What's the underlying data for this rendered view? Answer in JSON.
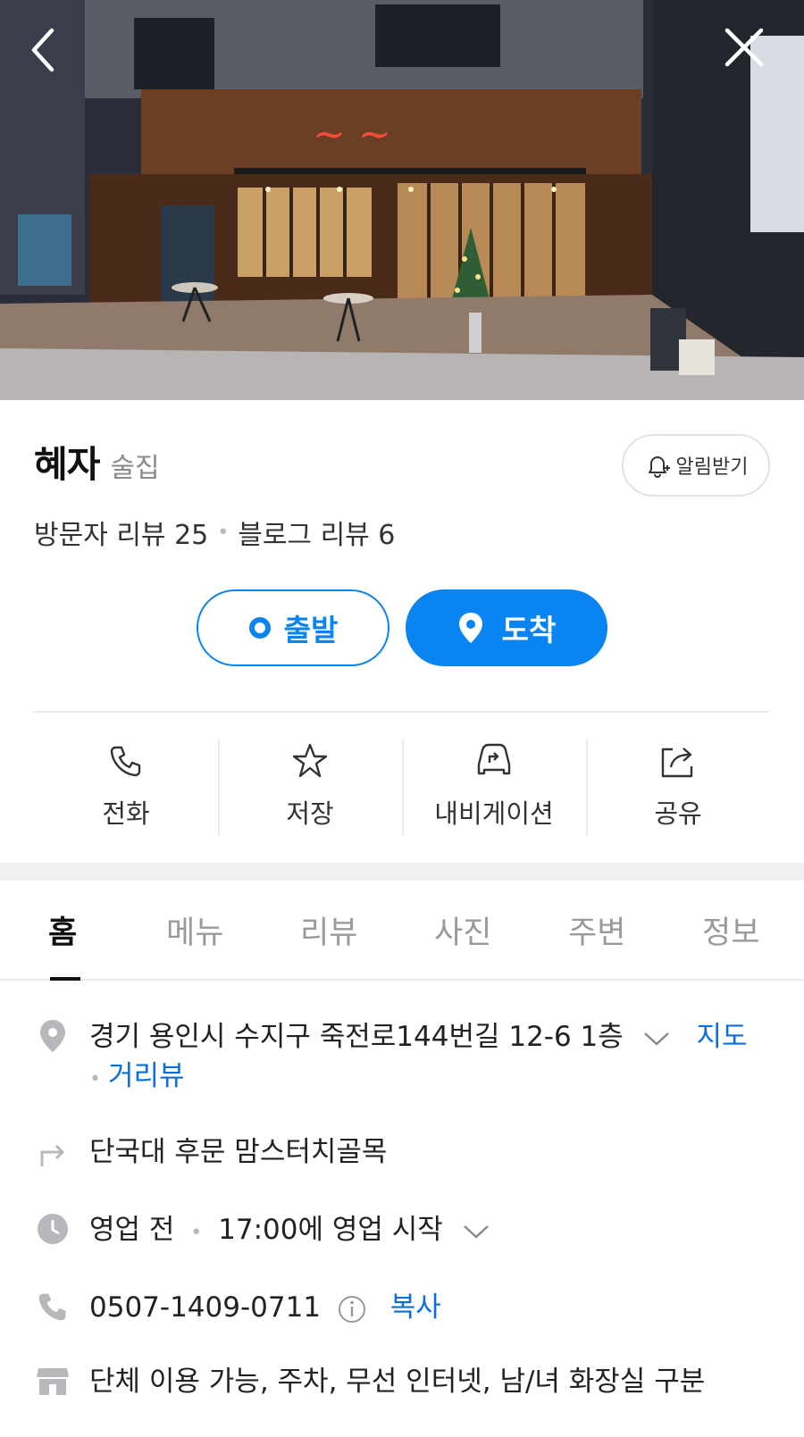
{
  "place": {
    "name": "혜자",
    "category": "술집",
    "alarm_label": "알림받기",
    "visitor_review": "방문자 리뷰 25",
    "blog_review": "블로그 리뷰 6"
  },
  "route": {
    "start_label": "출발",
    "end_label": "도착"
  },
  "actions": [
    {
      "label": "전화",
      "icon": "phone-icon"
    },
    {
      "label": "저장",
      "icon": "star-icon"
    },
    {
      "label": "내비게이션",
      "icon": "car-navigation-icon"
    },
    {
      "label": "공유",
      "icon": "share-icon"
    }
  ],
  "tabs": [
    {
      "label": "홈",
      "active": true
    },
    {
      "label": "메뉴",
      "active": false
    },
    {
      "label": "리뷰",
      "active": false
    },
    {
      "label": "사진",
      "active": false
    },
    {
      "label": "주변",
      "active": false
    },
    {
      "label": "정보",
      "active": false
    }
  ],
  "info": {
    "address": "경기 용인시 수지구 죽전로144번길 12-6 1층",
    "map_link": "지도",
    "street_view_link": "거리뷰",
    "directions": "단국대 후문 맘스터치골목",
    "hours_status": "영업 전",
    "hours_detail": "17:00에 영업 시작",
    "phone": "0507-1409-0711",
    "copy_link": "복사",
    "amenities": "단체 이용 가능, 주차, 무선 인터넷, 남/녀 화장실 구분"
  },
  "colors": {
    "accent": "#0a84f0",
    "link": "#0a6fd8",
    "muted": "#9a9a9a"
  }
}
